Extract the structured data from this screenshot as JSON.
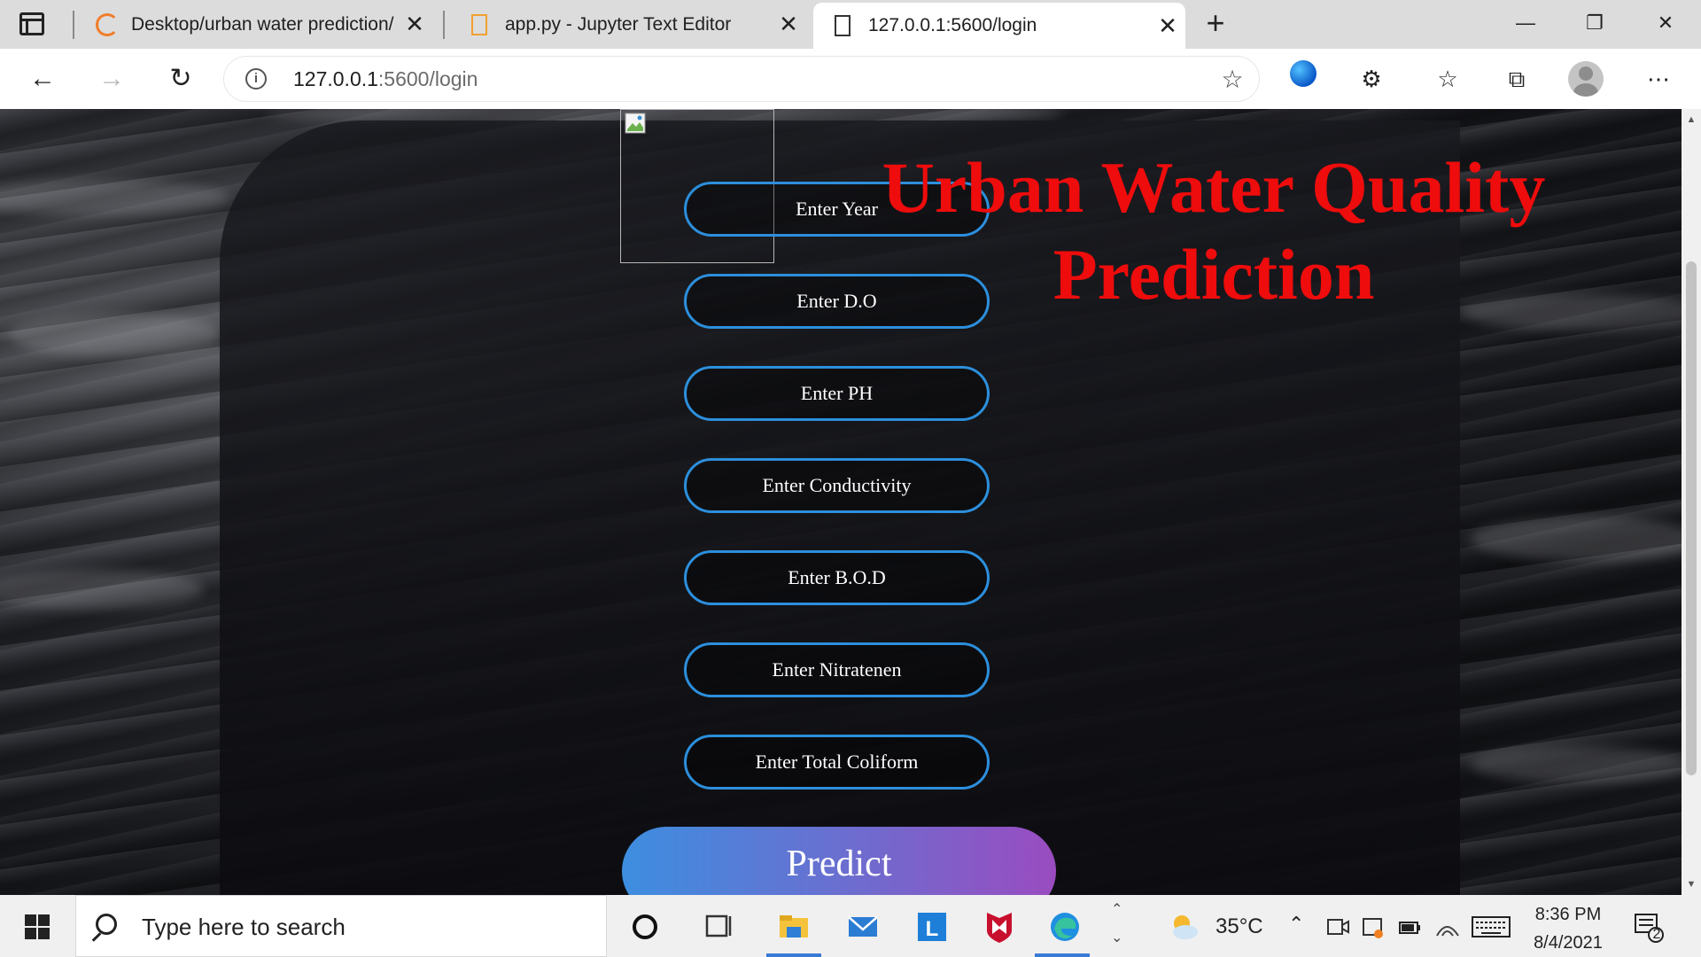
{
  "tabs": [
    {
      "title": "Desktop/urban water prediction/",
      "close": "✕"
    },
    {
      "title": "app.py - Jupyter Text Editor",
      "close": "✕"
    },
    {
      "title": "127.0.0.1:5600/login",
      "close": "✕"
    }
  ],
  "toolbar": {
    "url_host": "127.0.0.1",
    "url_path": ":5600/login"
  },
  "page": {
    "title": "Urban Water Quality Prediction",
    "fields": [
      "Enter Year",
      "Enter D.O",
      "Enter PH",
      "Enter Conductivity",
      "Enter B.O.D",
      "Enter Nitratenen",
      "Enter Total Coliform"
    ],
    "predict_label": "Predict"
  },
  "taskbar": {
    "search_placeholder": "Type here to search",
    "temperature": "35°C",
    "time": "8:36 PM",
    "date": "8/4/2021",
    "notification_count": "2"
  },
  "colors": {
    "title_red": "#ee0c0c",
    "field_border": "#2c8fdc",
    "predict_gradient_start": "#3d8ee0",
    "predict_gradient_end": "#9a4cc0"
  }
}
